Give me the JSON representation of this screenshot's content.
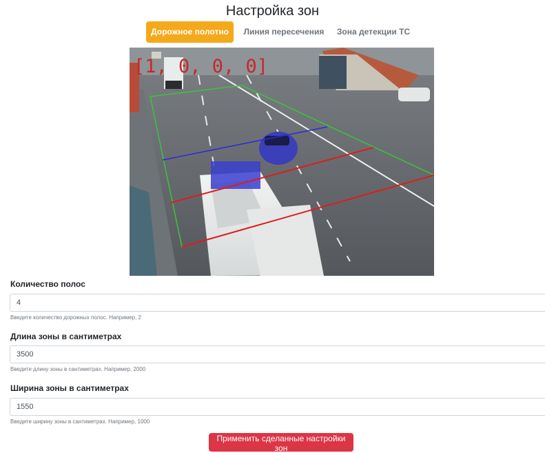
{
  "page": {
    "title": "Настройка зон"
  },
  "tabs": [
    {
      "label": "Дорожное полотно",
      "active": true
    },
    {
      "label": "Линия пересечения",
      "active": false
    },
    {
      "label": "Зона детекции ТС",
      "active": false
    }
  ],
  "camera": {
    "overlay_text": "[1, 0, 0, 0]",
    "zone_colors": {
      "zone_border": "#3cc43c",
      "crossing_line": "#2a2ad8",
      "lane_lines": "#e01b1b"
    }
  },
  "form": {
    "lanes": {
      "label": "Количество полос",
      "value": "4",
      "hint": "Введите количество дорожных полос. Например, 2"
    },
    "length": {
      "label": "Длина зоны в сантиметрах",
      "value": "3500",
      "hint": "Введите длину зоны в сантиметрах. Например, 2000"
    },
    "width": {
      "label": "Ширина зоны в сантиметрах",
      "value": "1550",
      "hint": "Введите ширину зоны в сантиметрах. Например, 1000"
    }
  },
  "apply_button": {
    "label": "Применить сделанные настройки зон"
  },
  "colors": {
    "accent_tab": "#f4a91b",
    "apply_button": "#dc3545"
  }
}
